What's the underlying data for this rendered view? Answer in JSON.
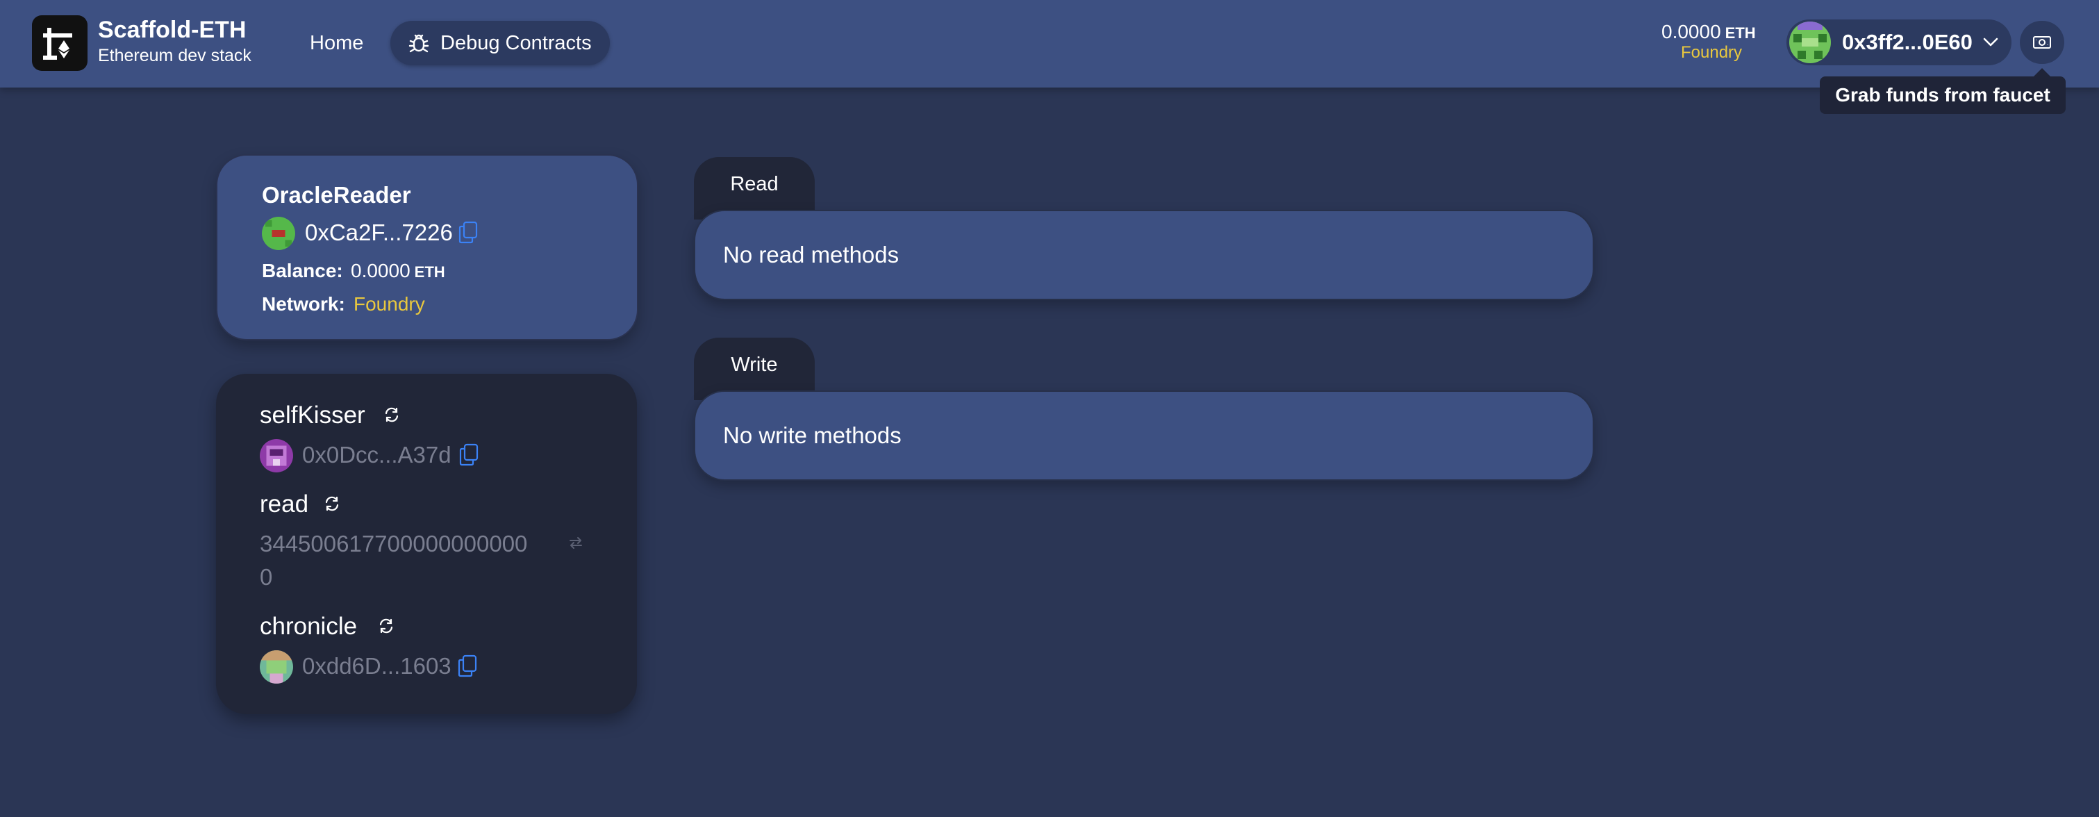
{
  "header": {
    "brand_title": "Scaffold-ETH",
    "brand_subtitle": "Ethereum dev stack",
    "nav": {
      "home": "Home",
      "debug": "Debug Contracts"
    },
    "balance": {
      "amount": "0.0000",
      "unit": "ETH",
      "network": "Foundry"
    },
    "account": {
      "address": "0x3ff2...0E60"
    },
    "faucet_tooltip": "Grab funds from faucet"
  },
  "contract": {
    "name": "OracleReader",
    "address": "0xCa2F...7226",
    "balance_label": "Balance:",
    "balance_value": "0.0000",
    "balance_unit": "ETH",
    "network_label": "Network:",
    "network_value": "Foundry"
  },
  "variables": [
    {
      "name": "selfKisser",
      "value": "0x0Dcc...A37d"
    },
    {
      "name": "read",
      "value_line1": "344500617700000000000",
      "value_line2": "0"
    },
    {
      "name": "chronicle",
      "value": "0xdd6D...1603"
    }
  ],
  "read_section": {
    "tab": "Read",
    "empty": "No read methods"
  },
  "write_section": {
    "tab": "Write",
    "empty": "No write methods"
  },
  "colors": {
    "page_bg": "#2b3655",
    "card_bg": "#3d5082",
    "dark_card_bg": "#212638",
    "network_accent": "#e9c83e",
    "muted_text": "#7a7e90",
    "copy_icon": "#3b82f6"
  },
  "icons": [
    "scaffold-logo-icon",
    "bug-icon",
    "chevron-down-icon",
    "faucet-icon",
    "copy-icon",
    "refresh-icon",
    "convert-icon"
  ]
}
